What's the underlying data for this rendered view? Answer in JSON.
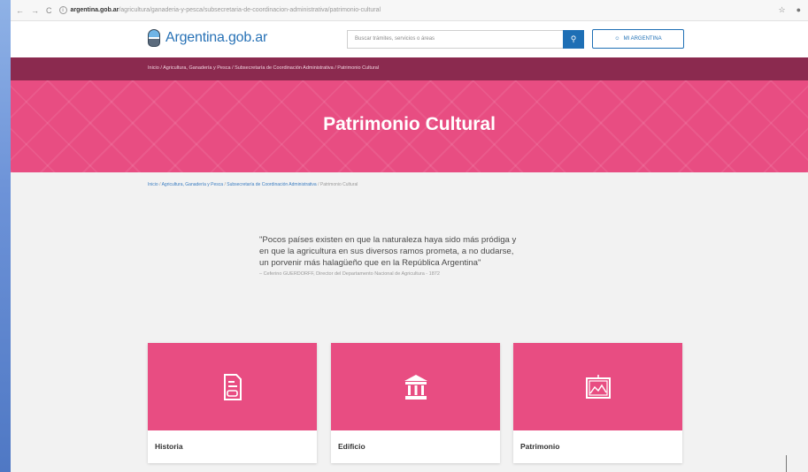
{
  "browser": {
    "url_host": "argentina.gob.ar",
    "url_path": "/agricultura/ganaderia-y-pesca/subsecretaria-de-coordinacion-administrativa/patrimonio-cultural"
  },
  "header": {
    "logo_text": "Argentina.gob.ar",
    "search_placeholder": "Buscar trámites, servicios o áreas",
    "mi_argentina": "MI ARGENTINA"
  },
  "topbar": {
    "breadcrumb": "Inicio / Agricultura, Ganadería y Pesca / Subsecretaría de Coordinación Administrativa / Patrimonio Cultural"
  },
  "hero": {
    "title": "Patrimonio Cultural"
  },
  "breadcrumb": {
    "items": [
      "Inicio",
      "Agricultura, Ganadería y Pesca",
      "Subsecretaría de Coordinación Administrativa"
    ],
    "current": "Patrimonio Cultural"
  },
  "quote": {
    "lines": [
      "\"Pocos países existen en que la naturaleza haya sido más pródiga y",
      "en que la agricultura en sus diversos ramos prometa, a no dudarse,",
      "un porvenir más halagüeño que en la República Argentina\""
    ],
    "author": "– Ceferino GUERDORFF, Director del Departamento Nacional de Agricultura - 1872"
  },
  "cards": [
    {
      "label": "Historia",
      "icon": "document-icon"
    },
    {
      "label": "Edificio",
      "icon": "building-icon"
    },
    {
      "label": "Patrimonio",
      "icon": "picture-frame-icon"
    }
  ],
  "colors": {
    "brand_pink": "#e84d82",
    "dark_bar": "#8b2a4f",
    "link_blue": "#2872b6"
  }
}
